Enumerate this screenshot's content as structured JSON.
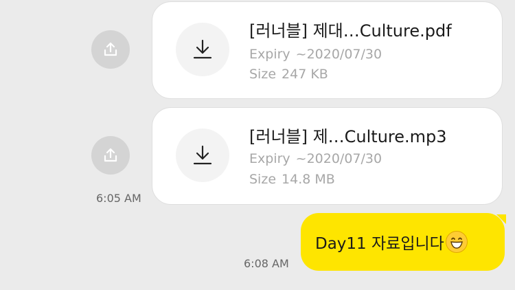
{
  "messages": {
    "files": [
      {
        "name": "[러너블] 제대…Culture.pdf",
        "expiry_label": "Expiry",
        "expiry_value": "~2020/07/30",
        "size_label": "Size",
        "size_value": "247 KB",
        "icon": "download-icon"
      },
      {
        "name": "[러너블] 제…Culture.mp3",
        "expiry_label": "Expiry",
        "expiry_value": "~2020/07/30",
        "size_label": "Size",
        "size_value": "14.8 MB",
        "icon": "download-icon"
      }
    ],
    "received_time": "6:05 AM",
    "sent": {
      "text": "Day11 자료입니다",
      "emoji": "grinning-face-emoji",
      "time": "6:08 AM"
    }
  },
  "colors": {
    "background": "#ebebeb",
    "sent_bubble": "#fee500",
    "card": "#ffffff",
    "share_button": "#d4d4d4"
  }
}
